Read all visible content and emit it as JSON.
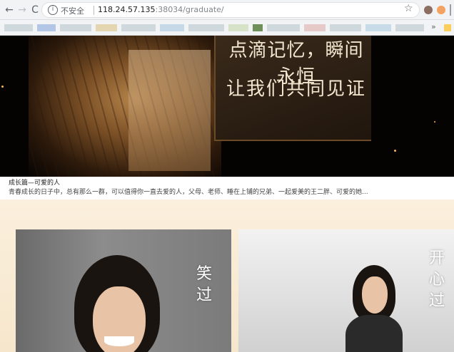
{
  "browser": {
    "back_icon": "arrow-left-icon",
    "forward_icon": "arrow-right-icon",
    "reload_icon": "reload-icon",
    "security_label": "不安全",
    "url_host": "118.24.57.135",
    "url_rest": ":38034/graduate/",
    "bookmarks_more": "»"
  },
  "banner": {
    "line1": "点滴记忆，瞬间永恒",
    "line2": "让我们共同见证"
  },
  "article": {
    "title": "成长篇—可爱的人",
    "description": "青春成长的日子中，总有那么一群，可以值得你一直去爱的人，父母、老师、睡在上铺的兄弟、一起爱美的王二胖、可爱的她..."
  },
  "gallery": {
    "left_caption": "笑过",
    "right_caption": "开心过"
  }
}
